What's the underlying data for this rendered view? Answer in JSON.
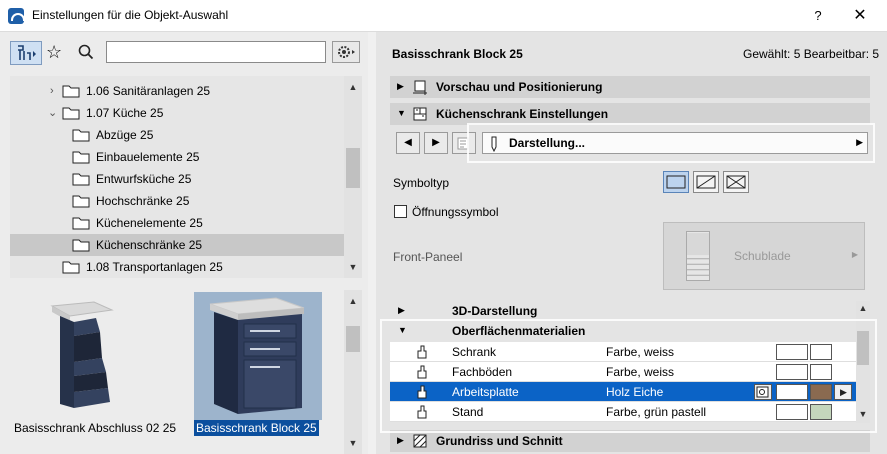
{
  "window": {
    "title": "Einstellungen für die Objekt-Auswahl",
    "help_label": "?",
    "close_label": "✕"
  },
  "left": {
    "search": {
      "value": "",
      "placeholder": ""
    },
    "tree": [
      {
        "label": "1.06 Sanitäranlagen 25",
        "level": 1,
        "arrow": "›"
      },
      {
        "label": "1.07 Küche 25",
        "level": 1,
        "arrow": "⌄"
      },
      {
        "label": "Abzüge 25",
        "level": 2,
        "arrow": ""
      },
      {
        "label": "Einbauelemente 25",
        "level": 2,
        "arrow": ""
      },
      {
        "label": "Entwurfsküche 25",
        "level": 2,
        "arrow": ""
      },
      {
        "label": "Hochschränke 25",
        "level": 2,
        "arrow": ""
      },
      {
        "label": "Küchenelemente 25",
        "level": 2,
        "arrow": ""
      },
      {
        "label": "Küchenschränke 25",
        "level": 2,
        "arrow": "",
        "selected": true
      },
      {
        "label": "1.08 Transportanlagen 25",
        "level": 1,
        "arrow": ""
      }
    ],
    "preview": [
      {
        "label": "Basisschrank Abschluss 02 25",
        "selected": false
      },
      {
        "label": "Basisschrank Block 25",
        "selected": true
      }
    ]
  },
  "right": {
    "object_name": "Basisschrank Block 25",
    "count_text": "Gewählt: 5 Bearbeitbar: 5",
    "sections": {
      "preview": "Vorschau und Positionierung",
      "kitchen": "Küchenschrank Einstellungen",
      "grundriss": "Grundriss und Schnitt"
    },
    "page_dropdown": "Darstellung...",
    "symboltyp_label": "Symboltyp",
    "opening_symbol_label": "Öffnungssymbol",
    "front_panel_label": "Front-Paneel",
    "front_panel_value": "Schublade",
    "sub_3d": "3D-Darstellung",
    "sub_materials": "Oberflächenmaterialien",
    "materials": [
      {
        "name": "Schrank",
        "value": "Farbe, weiss",
        "swatch": "#ffffff",
        "selected": false
      },
      {
        "name": "Fachböden",
        "value": "Farbe, weiss",
        "swatch": "#ffffff",
        "selected": false
      },
      {
        "name": "Arbeitsplatte",
        "value": "Holz Eiche",
        "swatch": "#8a6a50",
        "selected": true
      },
      {
        "name": "Stand",
        "value": "Farbe, grün pastell",
        "swatch": "#c4d6bc",
        "selected": false
      }
    ]
  },
  "colors": {
    "selection_blue": "#0b63c6",
    "selected_label_blue": "#0b4f9e",
    "cabinet_navy": "#2a3550"
  }
}
